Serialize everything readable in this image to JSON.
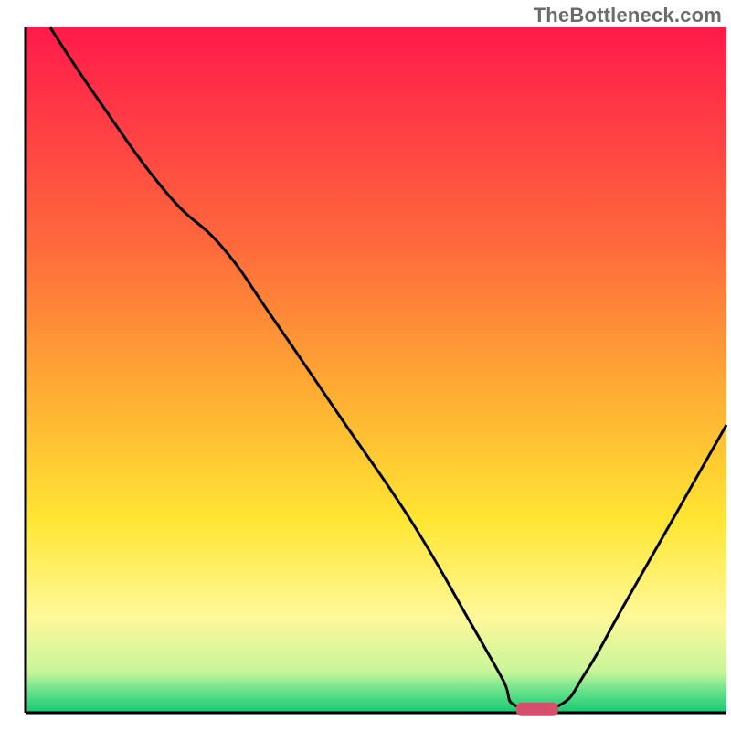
{
  "watermark": "TheBottleneck.com",
  "chart_data": {
    "type": "line",
    "title": "",
    "xlabel": "",
    "ylabel": "",
    "xlim": [
      0,
      100
    ],
    "ylim": [
      0,
      100
    ],
    "grid": false,
    "legend": false,
    "background_gradient_stops": [
      {
        "offset": 0.0,
        "color": "#ff1a4b"
      },
      {
        "offset": 0.32,
        "color": "#ff6a3c"
      },
      {
        "offset": 0.55,
        "color": "#ffb233"
      },
      {
        "offset": 0.72,
        "color": "#ffe633"
      },
      {
        "offset": 0.86,
        "color": "#fff899"
      },
      {
        "offset": 0.94,
        "color": "#c9f59a"
      },
      {
        "offset": 0.97,
        "color": "#63e08a"
      },
      {
        "offset": 1.0,
        "color": "#17c871"
      }
    ],
    "marker": {
      "x": 73,
      "y": 0.5,
      "width": 6,
      "height": 2,
      "color": "#d6506d"
    },
    "series": [
      {
        "name": "bottleneck-curve",
        "color": "#000000",
        "x": [
          3.5,
          10,
          20,
          28,
          35,
          45,
          55,
          63,
          68,
          70,
          76,
          80,
          85,
          90,
          95,
          100
        ],
        "y": [
          100,
          90,
          76,
          68,
          58,
          43,
          28,
          14,
          5,
          1,
          1,
          6,
          15,
          24,
          33,
          42
        ]
      }
    ]
  }
}
